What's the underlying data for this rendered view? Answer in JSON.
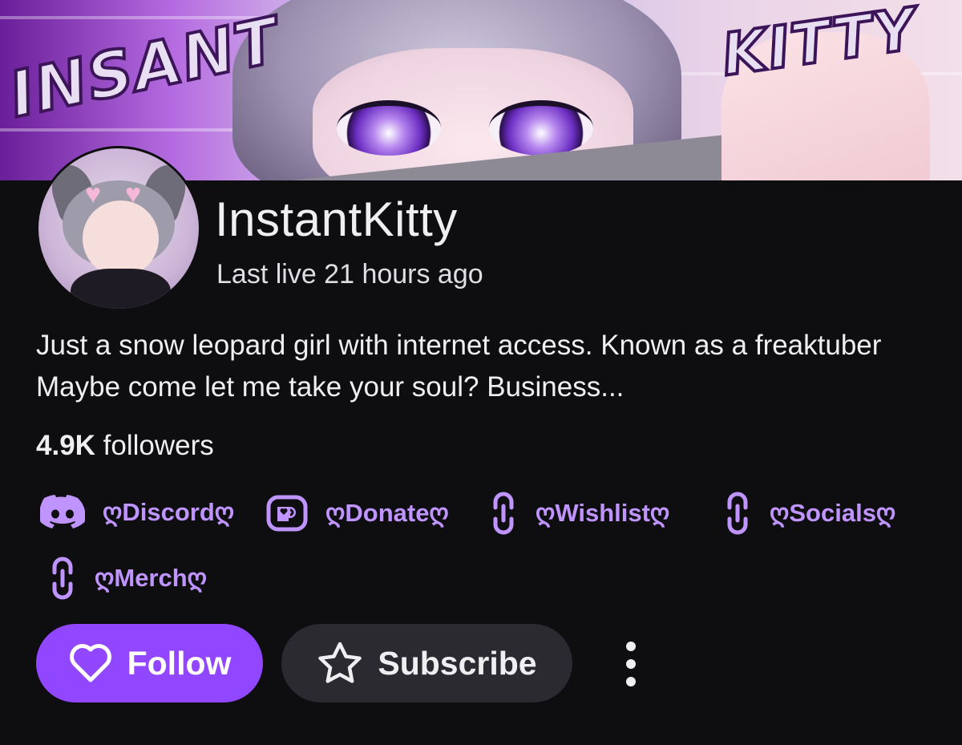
{
  "channel": {
    "name": "InstantKitty",
    "last_live": "Last live 21 hours ago",
    "bio": "Just a snow leopard girl with internet access. Known as a freaktuber Maybe come let me take your soul? Business...",
    "followers_count": "4.9K",
    "followers_label": "followers"
  },
  "banner": {
    "graffiti_left": "INSANT",
    "graffiti_right": "KITTY"
  },
  "links": [
    {
      "label": "ღDiscordღ",
      "icon": "discord-icon"
    },
    {
      "label": "ღDonateღ",
      "icon": "donate-icon"
    },
    {
      "label": "ღWishlistღ",
      "icon": "link-icon"
    },
    {
      "label": "ღSocialsღ",
      "icon": "link-icon"
    },
    {
      "label": "ღMerchღ",
      "icon": "link-icon"
    }
  ],
  "actions": {
    "follow_label": "Follow",
    "subscribe_label": "Subscribe"
  },
  "colors": {
    "background": "#0e0e10",
    "accent": "#9147ff",
    "link": "#bf94ff",
    "secondary_button": "#2a2a30"
  }
}
